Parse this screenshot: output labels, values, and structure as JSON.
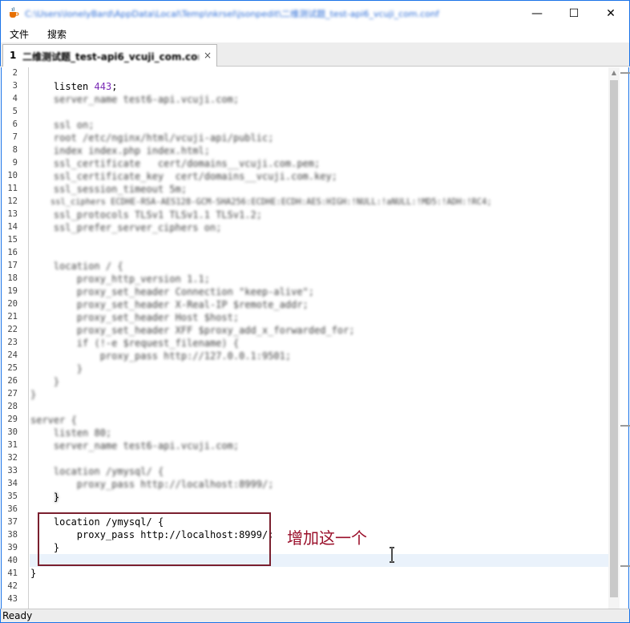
{
  "window": {
    "title": "C:\\Users\\lonelyBard\\AppData\\Local\\Temp\\nkrsel\\jsonpedit\\二维测试题_test-api6_vcuji_com.conf",
    "icons": {
      "app": "java-cup-icon",
      "minimize": "minimize-icon",
      "maximize": "maximize-icon",
      "close": "close-icon"
    },
    "min_glyph": "—",
    "max_glyph": "☐",
    "close_glyph": "✕"
  },
  "menu": {
    "file": "文件",
    "search": "搜索"
  },
  "tab": {
    "number": "1",
    "label": "二维测试题_test-api6_vcuji_com.conf",
    "close_glyph": "×"
  },
  "editor": {
    "line_numbers": [
      "2",
      "3",
      "4",
      "5",
      "6",
      "7",
      "8",
      "9",
      "10",
      "11",
      "12",
      "13",
      "14",
      "15",
      "16",
      "17",
      "18",
      "19",
      "20",
      "21",
      "22",
      "23",
      "24",
      "25",
      "26",
      "27",
      "28",
      "29",
      "30",
      "31",
      "32",
      "33",
      "34",
      "35",
      "36",
      "37",
      "38",
      "39",
      "40",
      "41",
      "42",
      "43"
    ],
    "visible_lines": {
      "l3_keyword": "listen",
      "l3_value": "443",
      "l3_end": ";",
      "l36": "    }",
      "l37": "    location /ymysql/ {",
      "l38": "        proxy_pass http://localhost:8999/;",
      "l39": "    }",
      "l41": "}"
    },
    "blurred_lines": {
      "l4": "    server_name test6-api.vcuji.com;",
      "l6": "    ssl on;",
      "l7": "    root /etc/nginx/html/vcuji-api/public;",
      "l8": "    index index.php index.html;",
      "l9": "    ssl_certificate   cert/domains__vcuji.com.pem;",
      "l10": "    ssl_certificate_key  cert/domains__vcuji.com.key;",
      "l11": "    ssl_session_timeout 5m;",
      "l12": "    ssl_ciphers ECDHE-RSA-AES128-GCM-SHA256:ECDHE:ECDH:AES:HIGH:!NULL:!aNULL:!MD5:!ADH:!RC4;",
      "l13": "    ssl_protocols TLSv1 TLSv1.1 TLSv1.2;",
      "l14": "    ssl_prefer_server_ciphers on;",
      "l17": "    location / {",
      "l18": "        proxy_http_version 1.1;",
      "l19": "        proxy_set_header Connection \"keep-alive\";",
      "l20": "        proxy_set_header X-Real-IP $remote_addr;",
      "l21": "        proxy_set_header Host $host;",
      "l22": "        proxy_set_header XFF $proxy_add_x_forwarded_for;",
      "l23": "        if (!-e $request_filename) {",
      "l24": "            proxy_pass http://127.0.0.1:9501;",
      "l25": "        }",
      "l26": "    }",
      "l27": "}",
      "l29": "server {",
      "l30": "    listen 80;",
      "l31": "    server_name test6-api.vcuji.com;",
      "l33": "    location /ymysql/ {",
      "l34": "        proxy_pass http://localhost:8999/;",
      "l35": "    }"
    }
  },
  "annotation": {
    "text": "增加这一个",
    "color": "#9a0f2a",
    "box_color": "#7a1f2e"
  },
  "status": {
    "text": "Ready"
  },
  "colors": {
    "accent": "#1a73e8",
    "number": "#7a2bb5",
    "string": "#e08a2a"
  }
}
